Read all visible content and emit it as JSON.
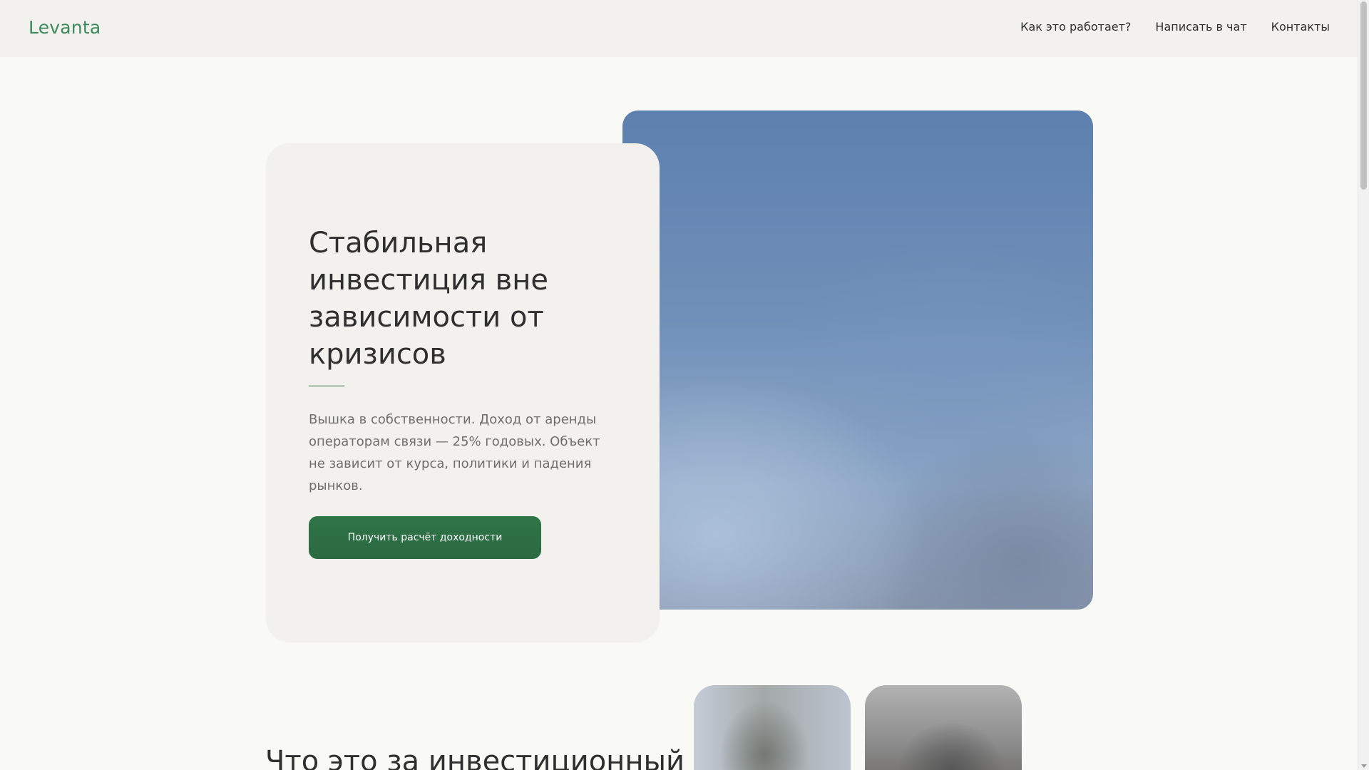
{
  "header": {
    "logo": "Levanta",
    "nav": [
      {
        "label": "Как это работает?"
      },
      {
        "label": "Написать в чат"
      },
      {
        "label": "Контакты"
      }
    ]
  },
  "hero": {
    "title": "Стабильная инвестиция вне зависимости от кризисов",
    "description": "Вышка в собственности. Доход от аренды операторам связи — 25% годовых. Объект не зависит от курса, политики и падения рынков.",
    "cta_label": "Получить расчёт доходности"
  },
  "section": {
    "title": "Что это за инвестиционный"
  },
  "colors": {
    "accent": "#3d8a5c",
    "button": "#2f7447",
    "background": "#f9f9f6",
    "card": "#f2f1ee"
  }
}
